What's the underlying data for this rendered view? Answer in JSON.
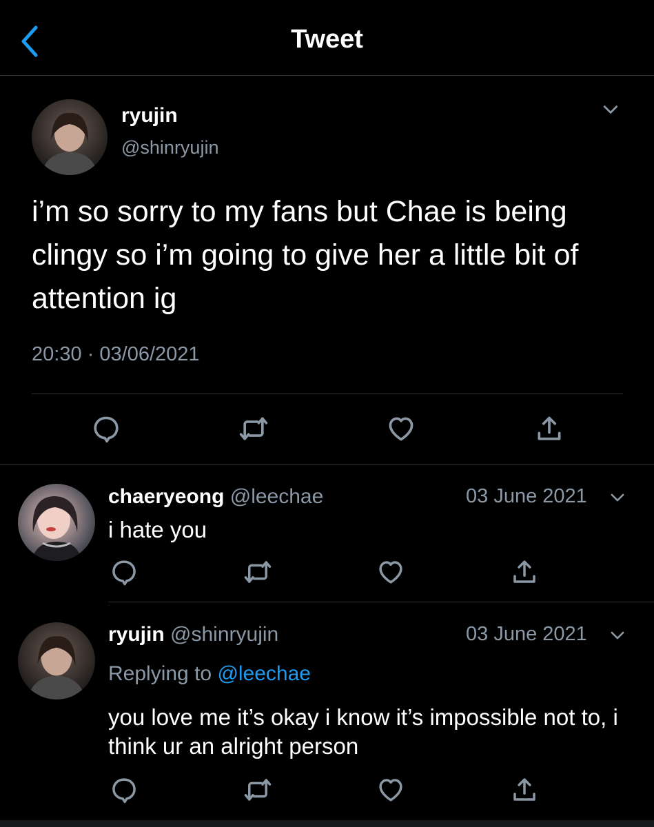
{
  "header": {
    "title": "Tweet",
    "back_icon": "chevron-left-icon"
  },
  "main_tweet": {
    "display_name": "ryujin",
    "handle": "@shinryujin",
    "text": "i’m so sorry to my fans but Chae is being clingy so i’m going to give her a little bit of attention ig",
    "time": "20:30",
    "separator": "·",
    "date": "03/06/2021"
  },
  "replies": [
    {
      "display_name": "chaeryeong",
      "handle": "@leechae",
      "date": "03 June 2021",
      "text": "i hate you"
    },
    {
      "display_name": "ryujin",
      "handle": "@shinryujin",
      "date": "03 June 2021",
      "replying_prefix": "Replying to",
      "replying_handle": "@leechae",
      "text": "you love me it’s okay i know it’s impossible not to, i think ur an alright person"
    }
  ],
  "icons": [
    "reply-icon",
    "retweet-icon",
    "like-icon",
    "share-icon"
  ],
  "colors": {
    "background": "#000000",
    "text": "#ffffff",
    "muted": "#8b98a5",
    "accent": "#1d9bf0",
    "divider": "#2f3336"
  }
}
